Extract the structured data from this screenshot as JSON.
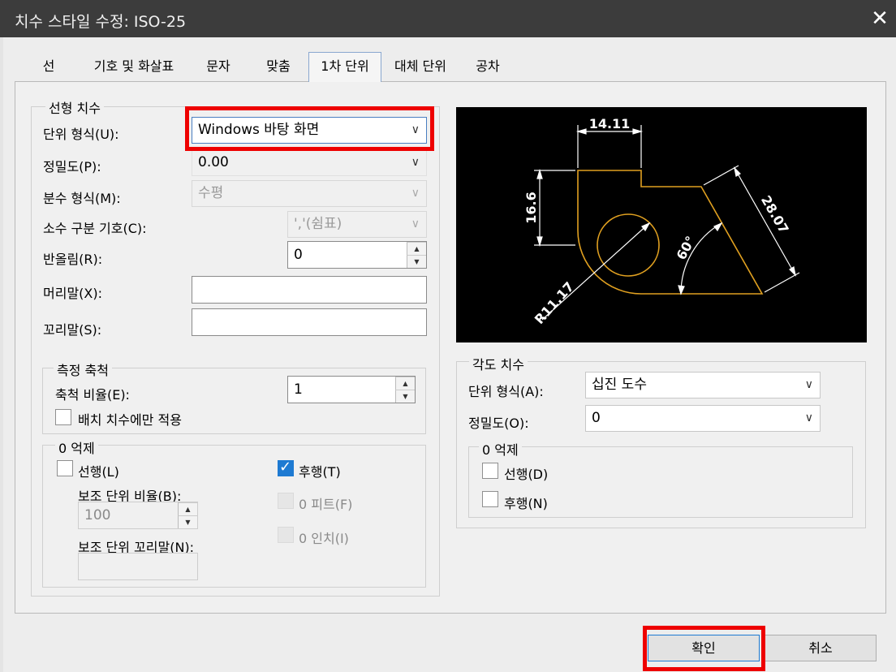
{
  "window": {
    "title": "치수 스타일 수정: ISO-25",
    "close_glyph": "✕"
  },
  "tabs": [
    {
      "label": "선"
    },
    {
      "label": "기호 및 화살표"
    },
    {
      "label": "문자"
    },
    {
      "label": "맞춤"
    },
    {
      "label": "1차 단위"
    },
    {
      "label": "대체 단위"
    },
    {
      "label": "공차"
    }
  ],
  "linear": {
    "title": "선형 치수",
    "unit_format_label": "단위 형식(U):",
    "unit_format_value": "Windows 바탕 화면",
    "precision_label": "정밀도(P):",
    "precision_value": "0.00",
    "fraction_label": "분수 형식(M):",
    "fraction_value": "수평",
    "decimal_sep_label": "소수 구분 기호(C):",
    "decimal_sep_value": "','(쉼표)",
    "round_label": "반올림(R):",
    "round_value": "0",
    "prefix_label": "머리말(X):",
    "prefix_value": "",
    "suffix_label": "꼬리말(S):",
    "suffix_value": ""
  },
  "scale": {
    "title": "측정 축척",
    "factor_label": "축척 비율(E):",
    "factor_value": "1",
    "layout_only_label": "배치 치수에만 적용"
  },
  "zero_linear": {
    "title": "0 억제",
    "leading_label": "선행(L)",
    "trailing_label": "후행(T)",
    "sub_factor_label": "보조 단위 비율(B):",
    "sub_factor_value": "100",
    "sub_suffix_label": "보조 단위 꼬리말(N):",
    "feet_label": "0 피트(F)",
    "inch_label": "0 인치(I)"
  },
  "preview": {
    "dim_top": "14.11",
    "dim_left": "16.6",
    "dim_right": "28.07",
    "dim_angle": "60°",
    "dim_radius": "R11.17",
    "colors": {
      "background": "#000000",
      "geometry": "#e0a020",
      "dims": "#ffffff"
    }
  },
  "angular": {
    "title": "각도 치수",
    "unit_format_label": "단위 형식(A):",
    "unit_format_value": "십진 도수",
    "precision_label": "정밀도(O):",
    "precision_value": "0",
    "zero_title": "0 억제",
    "leading_label": "선행(D)",
    "trailing_label": "후행(N)"
  },
  "buttons": {
    "ok": "확인",
    "cancel": "취소"
  },
  "colors": {
    "highlight": "#ee0000",
    "check_blue": "#1e7ad2",
    "titlebar": "#3c3c3c"
  }
}
